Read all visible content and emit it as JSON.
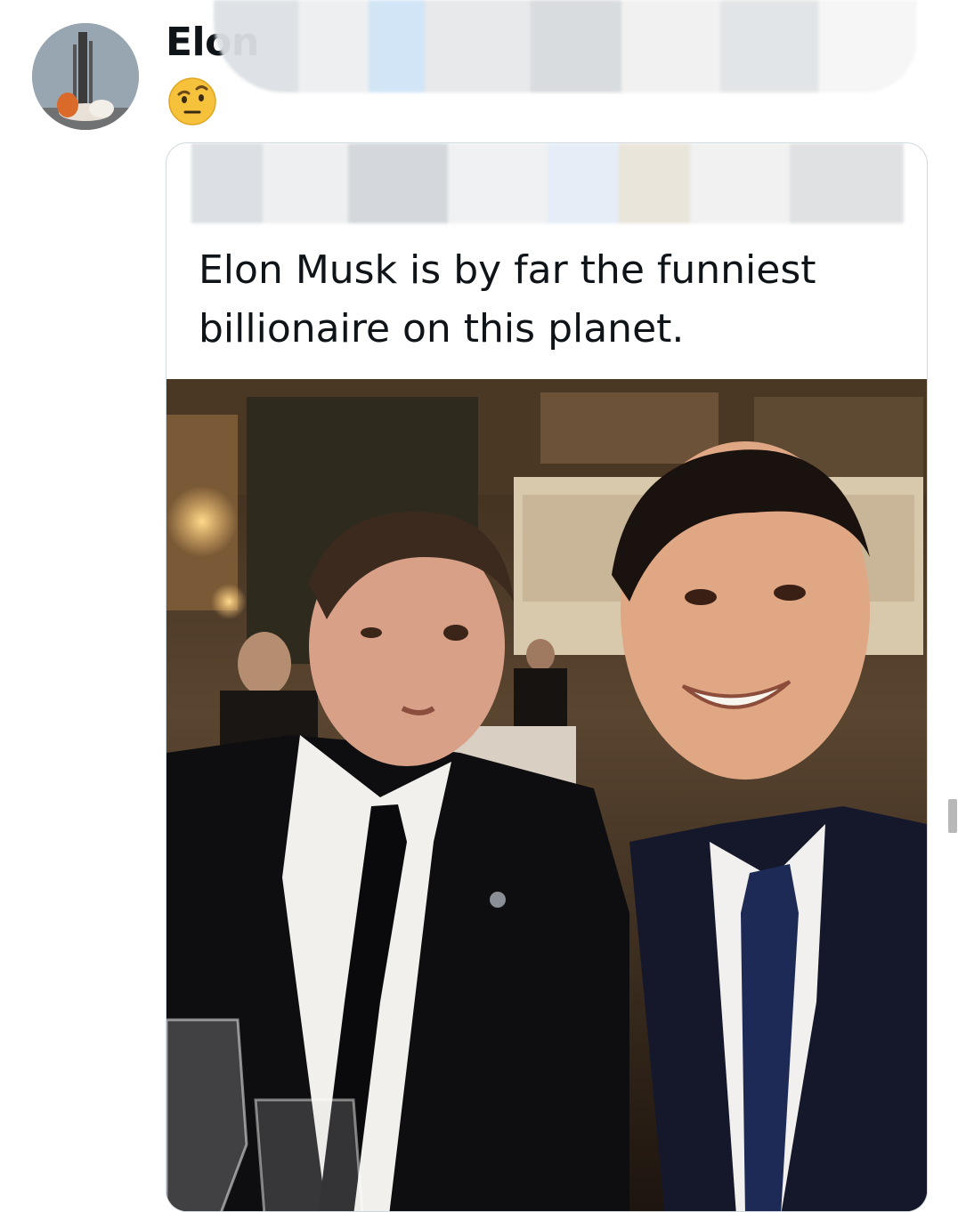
{
  "post": {
    "author_name": "Elon",
    "avatar_icon": "rocket-launch-avatar",
    "reply_emoji_icon": "face-with-raised-eyebrow-icon"
  },
  "quoted_post": {
    "text": "Elon Musk is by far the funniest billionaire on this planet.",
    "verified_icon": "verified-badge-icon"
  },
  "colors": {
    "text_primary": "#0f1419",
    "card_border": "#cfd9de",
    "background": "#ffffff"
  }
}
